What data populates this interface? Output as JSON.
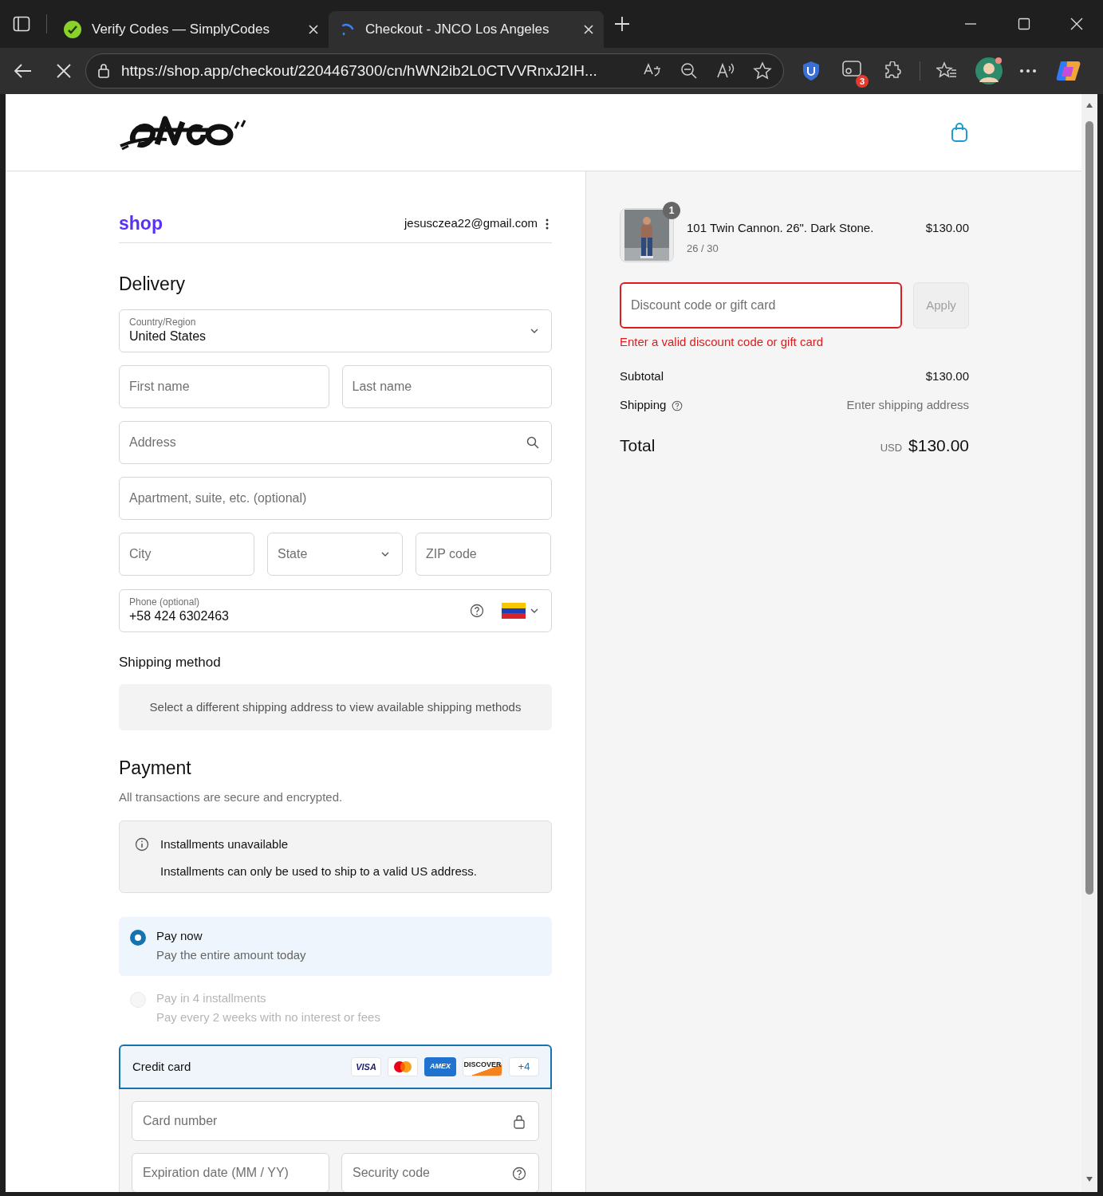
{
  "browser": {
    "tabs": [
      {
        "title": "Verify Codes — SimplyCodes",
        "selected": false,
        "loading": false
      },
      {
        "title": "Checkout - JNCO Los Angeles",
        "selected": true,
        "loading": true
      }
    ],
    "address": "https://shop.app/checkout/2204467300/cn/hWN2ib2L0CTVVRnxJ2IH...",
    "extension_badge": "3"
  },
  "account": {
    "brand": "shop",
    "email": "jesusczea22@gmail.com"
  },
  "delivery": {
    "title": "Delivery",
    "country": {
      "label": "Country/Region",
      "value": "United States"
    },
    "rows": [
      [
        {
          "placeholder": "First name",
          "kind": "text"
        },
        {
          "placeholder": "Last name",
          "kind": "text"
        }
      ],
      [
        {
          "placeholder": "Address",
          "kind": "search"
        }
      ],
      [
        {
          "placeholder": "Apartment, suite, etc. (optional)",
          "kind": "text"
        }
      ],
      [
        {
          "placeholder": "City",
          "kind": "text"
        },
        {
          "placeholder": "State",
          "kind": "select"
        },
        {
          "placeholder": "ZIP code",
          "kind": "text"
        }
      ]
    ],
    "phone": {
      "label": "Phone (optional)",
      "value": "+58 424 6302463"
    }
  },
  "shipping_method": {
    "title": "Shipping method",
    "message": "Select a different shipping address to view available shipping methods"
  },
  "payment": {
    "title": "Payment",
    "subtitle": "All transactions are secure and encrypted.",
    "notice": {
      "title": "Installments unavailable",
      "text": "Installments can only be used to ship to a valid US address."
    },
    "options": [
      {
        "label": "Pay now",
        "description": "Pay the entire amount today",
        "selected": true,
        "disabled": false
      },
      {
        "label": "Pay in 4 installments",
        "description": "Pay every 2 weeks with no interest or fees",
        "selected": false,
        "disabled": true
      }
    ],
    "method": {
      "label": "Credit card",
      "selected": true,
      "brands": [
        {
          "kind": "visa",
          "text": "VISA"
        },
        {
          "kind": "mastercard"
        },
        {
          "kind": "amex",
          "text": "AMEX"
        },
        {
          "kind": "discover",
          "text": "DISCOVER"
        },
        {
          "kind": "more",
          "text": "+4"
        }
      ]
    },
    "card_rows": [
      [
        {
          "placeholder": "Card number",
          "kind": "secure"
        }
      ],
      [
        {
          "placeholder": "Expiration date (MM / YY)",
          "kind": "plain"
        },
        {
          "placeholder": "Security code",
          "kind": "help"
        }
      ]
    ]
  },
  "summary": {
    "item": {
      "quantity": "1",
      "title": "101 Twin Cannon. 26\". Dark Stone.",
      "variant": "26 / 30",
      "price": "$130.00"
    },
    "discount": {
      "placeholder": "Discount code or gift card",
      "button": "Apply",
      "error": "Enter a valid discount code or gift card"
    },
    "lines": [
      {
        "label": "Subtotal",
        "value": "$130.00",
        "kind": "amount",
        "help": false
      },
      {
        "label": "Shipping",
        "value": "Enter shipping address",
        "kind": "note",
        "help": true
      }
    ],
    "total": {
      "label": "Total",
      "currency": "USD",
      "value": "$130.00"
    }
  }
}
